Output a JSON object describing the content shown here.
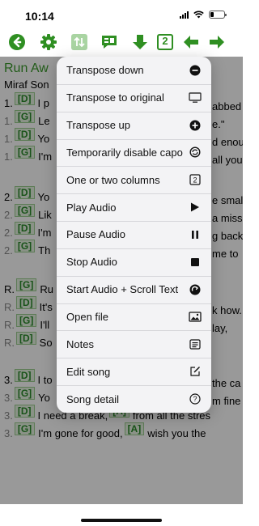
{
  "status_bar": {
    "time": "10:14"
  },
  "toolbar": {
    "icons": [
      "back-arrow-circle-icon",
      "gear-icon",
      "transpose-icon",
      "chat-chords-icon",
      "download-icon",
      "columns-icon",
      "arrow-left-icon",
      "arrow-right-icon"
    ],
    "columns_value": "2"
  },
  "song": {
    "title": "Run Aw",
    "artist": "Miraf Son",
    "lines": [
      {
        "num": "1.",
        "chord": "[D]",
        "text": "I p",
        "right": "abbed",
        "dim": false
      },
      {
        "num": "1.",
        "chord": "[G]",
        "text": "Le",
        "right": "e.\"",
        "dim": true
      },
      {
        "num": "1.",
        "chord": "[D]",
        "text": "Yo",
        "right": "d enou",
        "dim": true
      },
      {
        "num": "1.",
        "chord": "[G]",
        "text": "I'm",
        "right": "all you",
        "dim": true
      },
      {
        "num": "2.",
        "chord": "[D]",
        "text": "Yo",
        "right": "e smal",
        "dim": false
      },
      {
        "num": "2.",
        "chord": "[G]",
        "text": "Lik",
        "right": "a miss",
        "dim": true
      },
      {
        "num": "2.",
        "chord": "[D]",
        "text": "I'm",
        "right": "g back",
        "dim": true
      },
      {
        "num": "2.",
        "chord": "[G]",
        "text": "Th",
        "right": "me to",
        "dim": true
      },
      {
        "num": "R.",
        "chord": "[G]",
        "text": "Ru",
        "right": "",
        "dim": false
      },
      {
        "num": "R.",
        "chord": "[D]",
        "text": "It's",
        "right": "k how.",
        "dim": true
      },
      {
        "num": "R.",
        "chord": "[G]",
        "text": "I'll",
        "right": "lay,",
        "dim": true
      },
      {
        "num": "R.",
        "chord": "[D]",
        "text": "So",
        "right": "",
        "dim": true
      },
      {
        "num": "3.",
        "chord": "[D]",
        "text": "I to",
        "right": "the ca",
        "dim": false
      },
      {
        "num": "3.",
        "chord": "[G]",
        "text": "Yo",
        "right": "m fine",
        "dim": true
      },
      {
        "num": "3.",
        "chord": "[D]",
        "text": "I need a break,",
        "chord2": "[A]",
        "text2": "from all the stres",
        "dim": true
      },
      {
        "num": "3.",
        "chord": "[G]",
        "text": "I'm gone for good,",
        "chord2": "[A]",
        "text2": "wish you the",
        "dim": true
      }
    ]
  },
  "menu": {
    "items": [
      {
        "label": "Transpose down",
        "icon": "minus-circle-icon"
      },
      {
        "label": "Transpose to original",
        "icon": "monitor-icon"
      },
      {
        "label": "Transpose up",
        "icon": "plus-circle-icon"
      },
      {
        "label": "Temporarily disable capo",
        "icon": "capo-cycle-icon"
      },
      {
        "label": "One or two columns",
        "icon": "two-columns-icon"
      },
      {
        "label": "Play Audio",
        "icon": "play-icon"
      },
      {
        "label": "Pause Audio",
        "icon": "pause-icon"
      },
      {
        "label": "Stop Audio",
        "icon": "stop-icon"
      },
      {
        "label": "Start Audio + Scroll Text",
        "icon": "scroll-arrow-circle-icon"
      },
      {
        "label": "Open file",
        "icon": "image-icon"
      },
      {
        "label": "Notes",
        "icon": "notes-icon"
      },
      {
        "label": "Edit song",
        "icon": "edit-icon"
      },
      {
        "label": "Song detail",
        "icon": "question-circle-icon"
      }
    ]
  },
  "colors": {
    "accent_green": "#2f8f22",
    "chord_green": "#2a8a2a"
  }
}
